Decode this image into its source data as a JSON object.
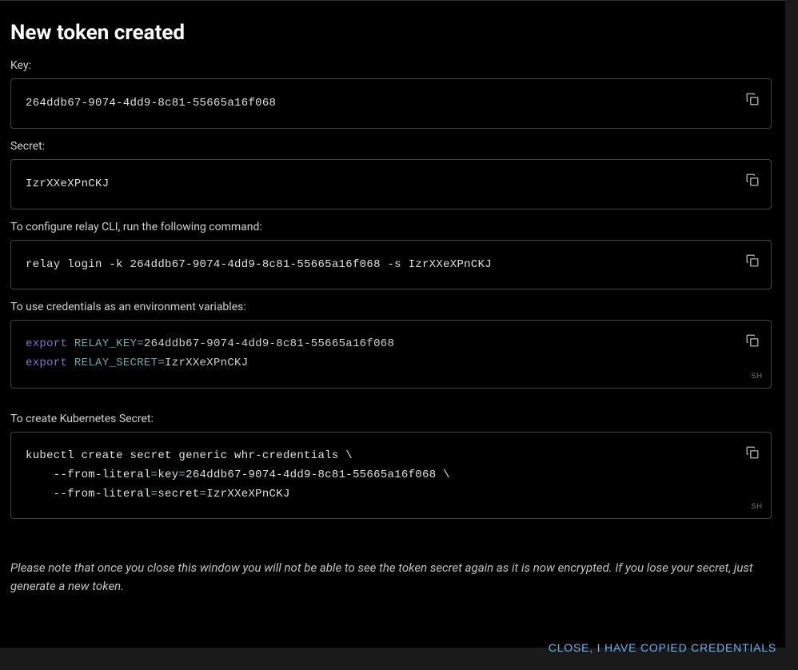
{
  "modal": {
    "title": "New token created",
    "key_label": "Key:",
    "key_value": "264ddb67-9074-4dd9-8c81-55665a16f068",
    "secret_label": "Secret:",
    "secret_value": "IzrXXeXPnCKJ",
    "cli_label": "To configure relay CLI, run the following command:",
    "cli_command": "relay login -k 264ddb67-9074-4dd9-8c81-55665a16f068 -s IzrXXeXPnCKJ",
    "env_label": "To use credentials as an environment variables:",
    "env_export_keyword": "export",
    "env_key_var": "RELAY_KEY",
    "env_key_val": "264ddb67-9074-4dd9-8c81-55665a16f068",
    "env_secret_var": "RELAY_SECRET",
    "env_secret_val": "IzrXXeXPnCKJ",
    "k8s_label": "To create Kubernetes Secret:",
    "k8s_line1": "kubectl create secret generic whr-credentials \\",
    "k8s_line2_prefix": "    --from-literal",
    "k8s_line2_key": "key",
    "k8s_line2_val": "264ddb67-9074-4dd9-8c81-55665a16f068 \\",
    "k8s_line3_prefix": "    --from-literal",
    "k8s_line3_key": "secret",
    "k8s_line3_val": "IzrXXeXPnCKJ",
    "lang_badge": "SH",
    "note": "Please note that once you close this window you will not be able to see the token secret again as it is now encrypted. If you lose your secret, just generate a new token.",
    "close_button": "CLOSE, I HAVE COPIED CREDENTIALS"
  }
}
